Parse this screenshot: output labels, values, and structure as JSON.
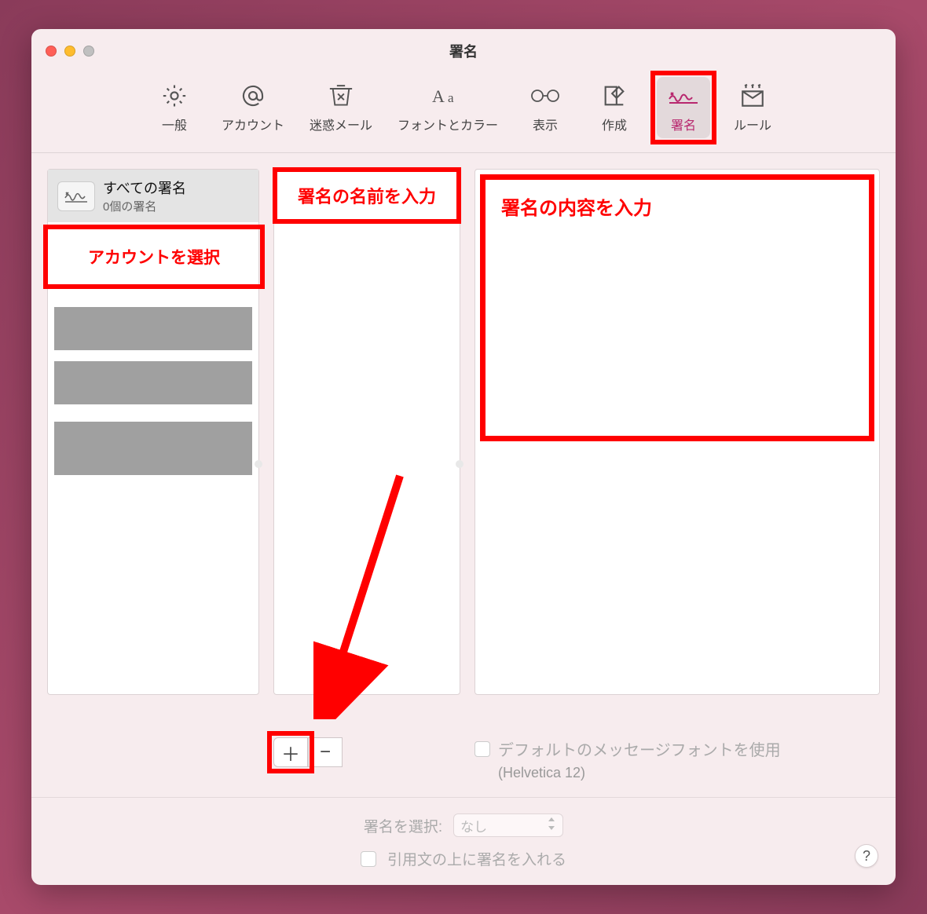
{
  "window": {
    "title": "署名"
  },
  "toolbar": {
    "general": "一般",
    "accounts": "アカウント",
    "junk": "迷惑メール",
    "fonts": "フォントとカラー",
    "viewing": "表示",
    "composing": "作成",
    "signatures": "署名",
    "rules": "ルール"
  },
  "accounts_panel": {
    "all_title": "すべての署名",
    "all_sub": "0個の署名",
    "select_hint": "アカウントを選択"
  },
  "names_panel": {
    "hint": "署名の名前を入力"
  },
  "body_panel": {
    "hint": "署名の内容を入力"
  },
  "buttons": {
    "add": "＋",
    "remove": "−"
  },
  "default_font_checkbox": "デフォルトのメッセージフォントを使用",
  "default_font_note": "(Helvetica 12)",
  "choose_signature_label": "署名を選択:",
  "choose_signature_value": "なし",
  "place_above_quote": "引用文の上に署名を入れる",
  "help": "?"
}
